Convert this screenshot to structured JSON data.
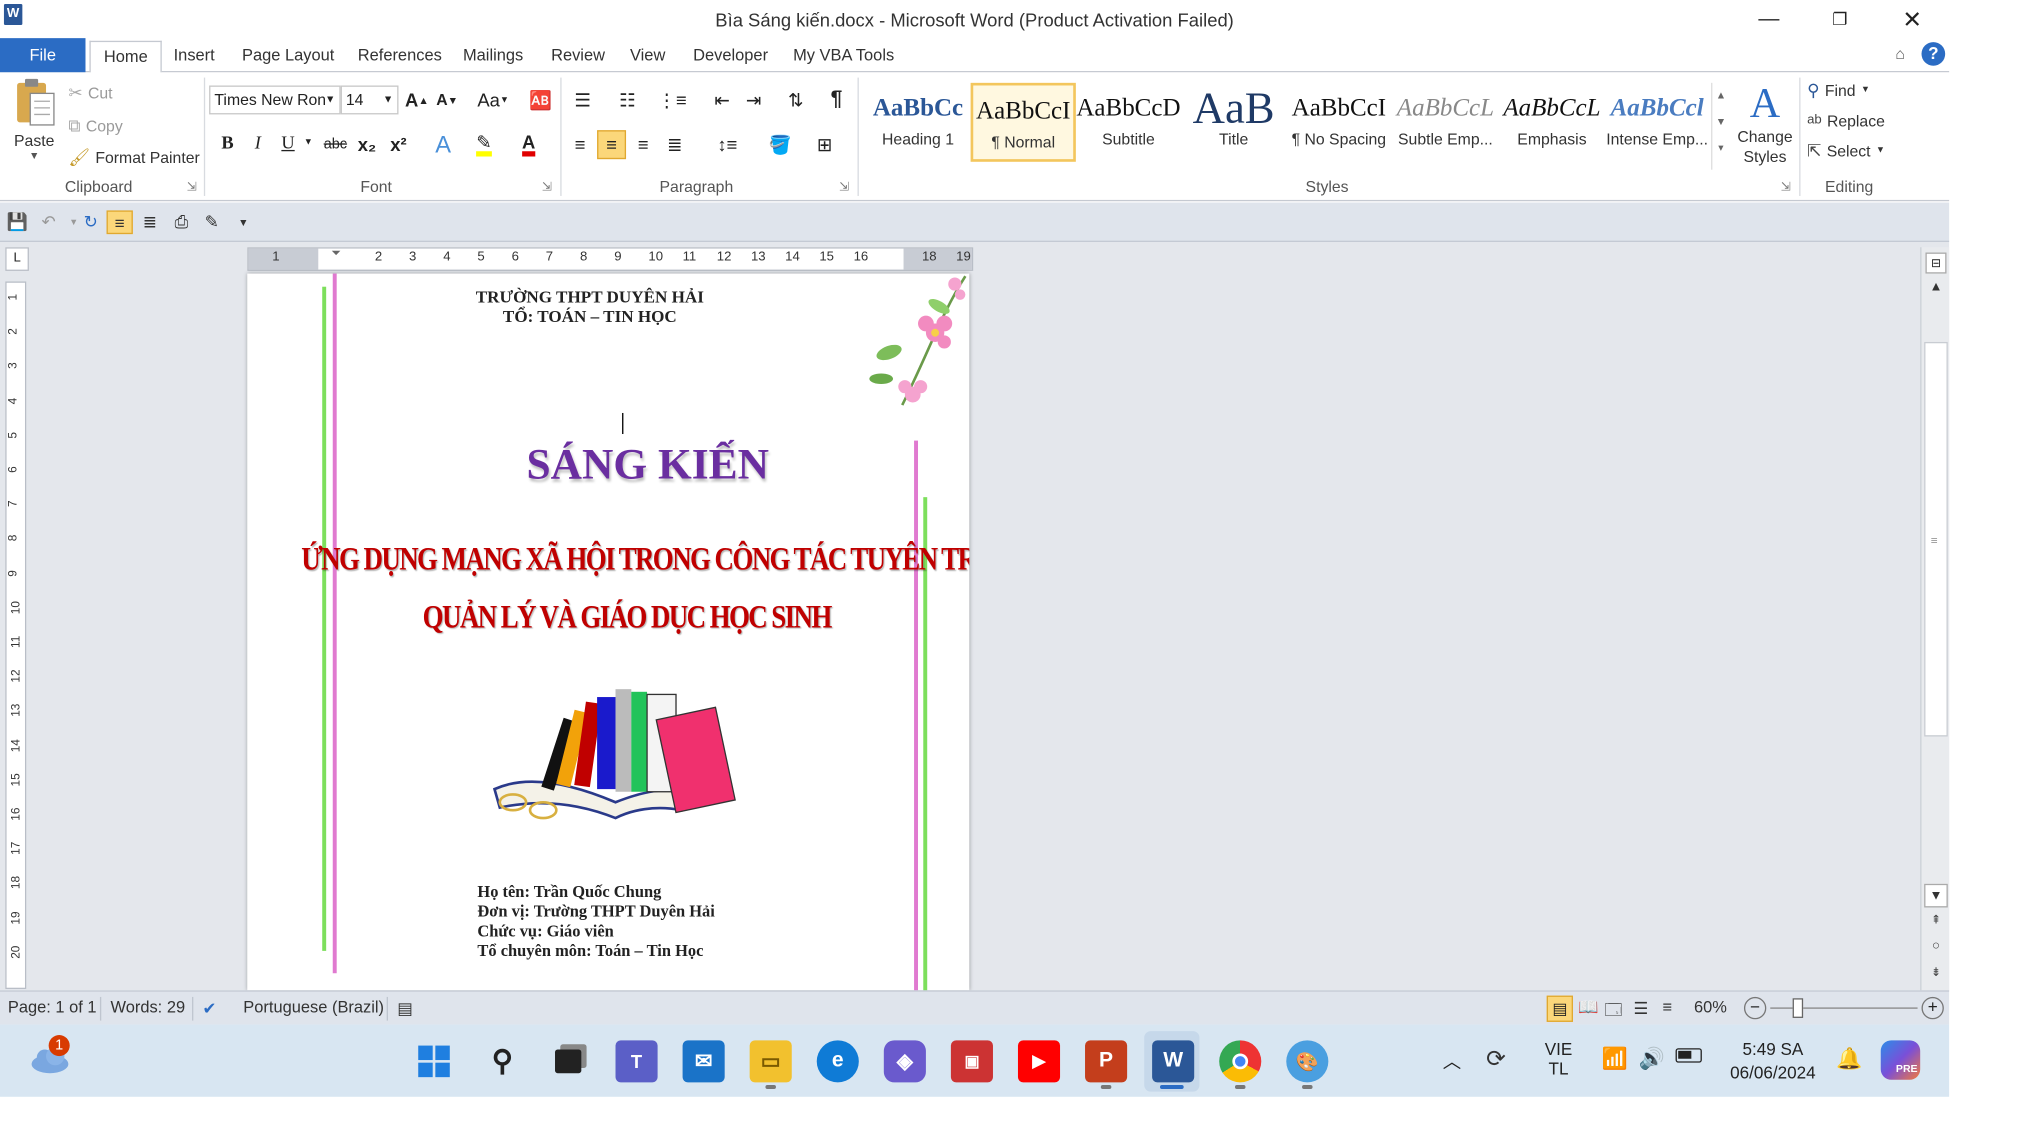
{
  "window": {
    "title": "Bìa Sáng kiến.docx - Microsoft Word (Product Activation Failed)",
    "app_icon": "W",
    "controls": [
      "minimize-icon",
      "restore-icon",
      "close-icon"
    ]
  },
  "tabs": [
    "File",
    "Home",
    "Insert",
    "Page Layout",
    "References",
    "Mailings",
    "Review",
    "View",
    "Developer",
    "My VBA Tools"
  ],
  "active_tab": "Home",
  "clipboard": {
    "paste": "Paste",
    "cut": "Cut",
    "copy": "Copy",
    "format_painter": "Format Painter",
    "label": "Clipboard"
  },
  "font": {
    "name": "Times New Ron",
    "size": "14",
    "label": "Font",
    "grow": "A",
    "shrink": "A",
    "case": "Aa",
    "bold": "B",
    "italic": "I",
    "underline": "U",
    "strike": "abc",
    "subscript": "x₂",
    "superscript": "x²"
  },
  "paragraph": {
    "label": "Paragraph",
    "pilcrow": "¶"
  },
  "styles": {
    "label": "Styles",
    "items": [
      {
        "sample": "AaBbCc",
        "name": "Heading 1"
      },
      {
        "sample": "AaBbCcI",
        "name": "¶ Normal"
      },
      {
        "sample": "AaBbCcD",
        "name": "Subtitle"
      },
      {
        "sample": "AaB",
        "name": "Title"
      },
      {
        "sample": "AaBbCcI",
        "name": "¶ No Spacing"
      },
      {
        "sample": "AaBbCcL",
        "name": "Subtle Emp..."
      },
      {
        "sample": "AaBbCcL",
        "name": "Emphasis"
      },
      {
        "sample": "AaBbCcl",
        "name": "Intense Emp..."
      }
    ],
    "selected_index": 1,
    "change_styles": "Change Styles"
  },
  "editing": {
    "label": "Editing",
    "find": "Find",
    "replace": "Replace",
    "select": "Select"
  },
  "ruler": {
    "h_ticks": [
      "1",
      "2",
      "3",
      "4",
      "5",
      "6",
      "7",
      "8",
      "9",
      "10",
      "11",
      "12",
      "13",
      "14",
      "15",
      "16",
      "18",
      "19"
    ],
    "v_ticks": [
      "1",
      "2",
      "3",
      "4",
      "5",
      "6",
      "7",
      "8",
      "9",
      "10",
      "11",
      "12",
      "13",
      "14",
      "15",
      "16",
      "17",
      "18",
      "19",
      "20"
    ]
  },
  "document": {
    "school": "TRƯỜNG THPT DUYÊN HẢI",
    "dept": "TỔ: TOÁN – TIN HỌC",
    "heading": "SÁNG KIẾN",
    "topic_line1": "ỨNG DỤNG MẠNG XÃ HỘI TRONG CÔNG TÁC TUYÊN TRUYỀN,",
    "topic_line2": "QUẢN LÝ VÀ GIÁO DỤC HỌC SINH",
    "info": [
      "Họ tên: Trần Quốc Chung",
      "Đơn vị: Trường THPT Duyên Hải",
      "Chức vụ: Giáo viên",
      "Tổ chuyên môn: Toán – Tin Học"
    ]
  },
  "status": {
    "page": "Page: 1 of 1",
    "words": "Words: 29",
    "language": "Portuguese (Brazil)",
    "zoom": "60%",
    "zoom_level": 0.6
  },
  "taskbar": {
    "notification_count": "1",
    "lang_top": "VIE",
    "lang_bottom": "TL",
    "time": "5:49 SA",
    "date": "06/06/2024",
    "pre_badge": "PRE",
    "colors": {
      "word": "#2b5797",
      "accent": "#2b6cc4",
      "youtube": "#ff0000",
      "powerpoint": "#c43e1c",
      "edge": "#0f7bd6",
      "mail": "#1a73c8"
    }
  },
  "colors": {
    "heading_purple": "#6a2ea0",
    "topic_red": "#c00000",
    "border_green": "#7ddf5c",
    "border_pink": "#e07ad0",
    "tab_file": "#2b6cc4"
  }
}
